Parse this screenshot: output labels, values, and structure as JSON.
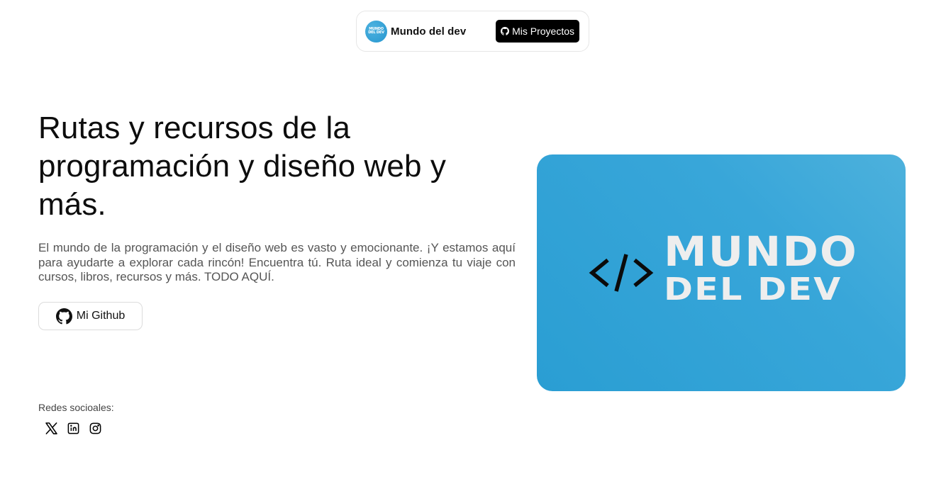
{
  "navbar": {
    "brand_logo_text_line1": "MUNDO",
    "brand_logo_text_line2": "DEL DEV",
    "brand_name": "Mundo del dev",
    "projects_button": "Mis Proyectos",
    "projects_icon": "github-icon"
  },
  "hero": {
    "title": "Rutas y recursos de la programación y diseño web y más.",
    "description": "El mundo de la programación y el diseño web es vasto y emocionante. ¡Y estamos aquí para ayudarte a explorar cada rincón! Encuentra tú. Ruta ideal y comienza tu viaje con cursos, libros, recursos y más. TODO AQUÍ.",
    "github_button": "Mi Github",
    "github_icon": "github-icon"
  },
  "social": {
    "label": "Redes socioales:",
    "icons": [
      "x-twitter-icon",
      "linkedin-icon",
      "instagram-icon"
    ]
  },
  "card": {
    "line1": "MUNDO",
    "line2": "DEL DEV",
    "code_icon": "code-brackets-icon"
  },
  "colors": {
    "card_blue": "#2a9ed3",
    "card_blue_light": "#4db1dc",
    "button_dark": "#000000",
    "text_muted": "#555555"
  }
}
